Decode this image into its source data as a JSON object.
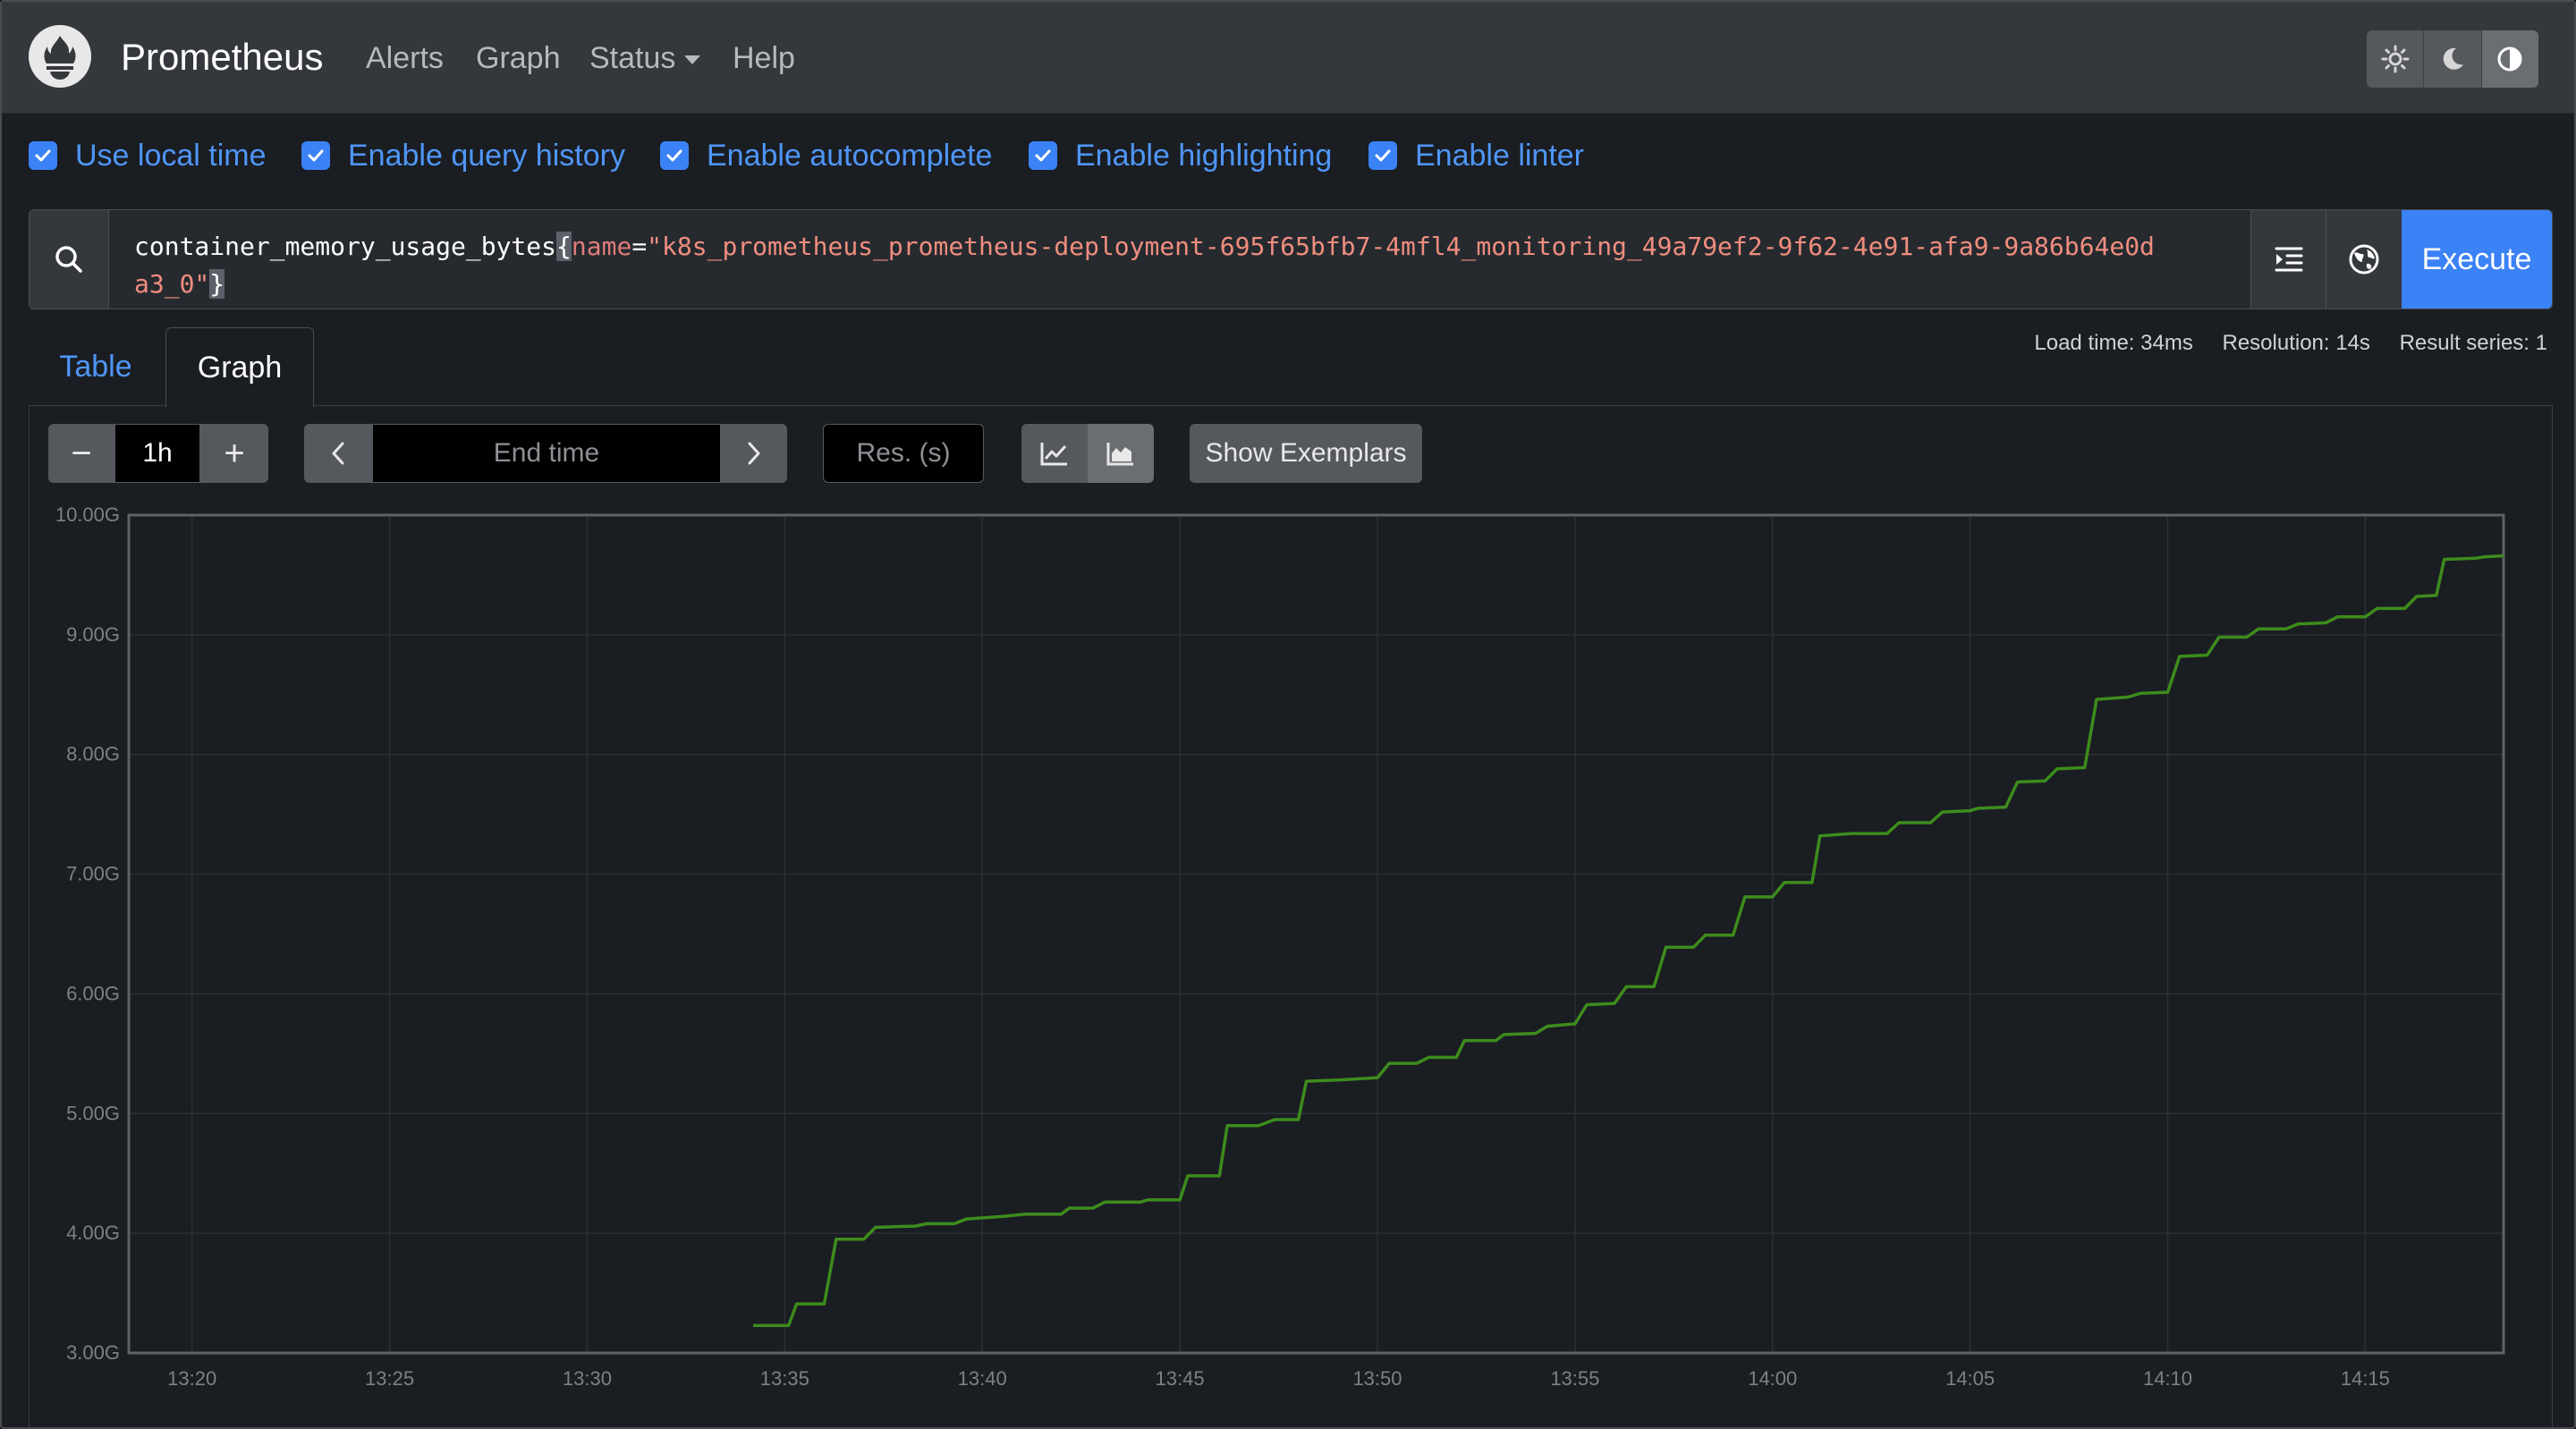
{
  "nav": {
    "brand": "Prometheus",
    "links": [
      "Alerts",
      "Graph",
      "Status",
      "Help"
    ],
    "theme_icons": [
      "sun-icon",
      "moon-icon",
      "half-circle-icon"
    ]
  },
  "options": [
    {
      "label": "Use local time",
      "checked": true
    },
    {
      "label": "Enable query history",
      "checked": true
    },
    {
      "label": "Enable autocomplete",
      "checked": true
    },
    {
      "label": "Enable highlighting",
      "checked": true
    },
    {
      "label": "Enable linter",
      "checked": true
    }
  ],
  "query": {
    "metric": "container_memory_usage_bytes",
    "open_brace": "{",
    "label": "name",
    "operator": "=",
    "value": "\"k8s_prometheus_prometheus-deployment-695f65bfb7-4mfl4_monitoring_49a79ef2-9f62-4e91-afa9-9a86b64e0da3_0\"",
    "close_brace": "}",
    "execute_label": "Execute"
  },
  "tabs": {
    "table": "Table",
    "graph": "Graph",
    "active": "Graph"
  },
  "stats": {
    "load_time": "Load time: 34ms",
    "resolution": "Resolution: 14s",
    "result_series": "Result series: 1"
  },
  "graph_controls": {
    "range_value": "1h",
    "minus": "−",
    "plus": "+",
    "end_time_placeholder": "End time",
    "resolution_placeholder": "Res. (s)",
    "show_exemplars": "Show Exemplars"
  },
  "colors": {
    "accent": "#3b82f6",
    "series": "#3d8c1c",
    "background": "#1a1d22"
  },
  "chart_data": {
    "type": "line",
    "ylim": [
      3.0,
      10.0
    ],
    "yticks": [
      3,
      4,
      5,
      6,
      7,
      8,
      9,
      10
    ],
    "ytick_labels": [
      "3.00G",
      "4.00G",
      "5.00G",
      "6.00G",
      "7.00G",
      "8.00G",
      "9.00G",
      "10.00G"
    ],
    "xlim_minutes": [
      1098.4,
      1158.5
    ],
    "xticks_minutes": [
      1100,
      1105,
      1110,
      1115,
      1120,
      1125,
      1130,
      1135,
      1140,
      1145,
      1150,
      1155
    ],
    "xtick_labels": [
      "13:20",
      "13:25",
      "13:30",
      "13:35",
      "13:40",
      "13:45",
      "13:50",
      "13:55",
      "14:00",
      "14:05",
      "14:10",
      "14:15"
    ],
    "grid": true,
    "series": [
      {
        "values": [
          [
            1114.2,
            3.23
          ],
          [
            1115.1,
            3.23
          ],
          [
            1115.3,
            3.41
          ],
          [
            1116.0,
            3.41
          ],
          [
            1116.3,
            3.95
          ],
          [
            1117.0,
            3.95
          ],
          [
            1117.3,
            4.05
          ],
          [
            1118.3,
            4.06
          ],
          [
            1118.6,
            4.08
          ],
          [
            1119.3,
            4.08
          ],
          [
            1119.6,
            4.12
          ],
          [
            1120.5,
            4.14
          ],
          [
            1121.1,
            4.16
          ],
          [
            1122.0,
            4.16
          ],
          [
            1122.2,
            4.21
          ],
          [
            1122.8,
            4.21
          ],
          [
            1123.1,
            4.26
          ],
          [
            1124.0,
            4.26
          ],
          [
            1124.2,
            4.28
          ],
          [
            1125.0,
            4.28
          ],
          [
            1125.2,
            4.48
          ],
          [
            1126.0,
            4.48
          ],
          [
            1126.2,
            4.9
          ],
          [
            1127.0,
            4.9
          ],
          [
            1127.4,
            4.95
          ],
          [
            1128.0,
            4.95
          ],
          [
            1128.2,
            5.27
          ],
          [
            1129.0,
            5.28
          ],
          [
            1130.0,
            5.3
          ],
          [
            1130.3,
            5.42
          ],
          [
            1131.0,
            5.42
          ],
          [
            1131.3,
            5.47
          ],
          [
            1132.0,
            5.47
          ],
          [
            1132.2,
            5.61
          ],
          [
            1133.0,
            5.61
          ],
          [
            1133.2,
            5.66
          ],
          [
            1134.0,
            5.67
          ],
          [
            1134.3,
            5.73
          ],
          [
            1135.0,
            5.75
          ],
          [
            1135.3,
            5.91
          ],
          [
            1136.0,
            5.92
          ],
          [
            1136.3,
            6.06
          ],
          [
            1137.0,
            6.06
          ],
          [
            1137.3,
            6.39
          ],
          [
            1138.0,
            6.39
          ],
          [
            1138.3,
            6.49
          ],
          [
            1139.0,
            6.49
          ],
          [
            1139.3,
            6.81
          ],
          [
            1140.0,
            6.81
          ],
          [
            1140.3,
            6.93
          ],
          [
            1141.0,
            6.93
          ],
          [
            1141.2,
            7.32
          ],
          [
            1142.0,
            7.34
          ],
          [
            1142.9,
            7.34
          ],
          [
            1143.2,
            7.43
          ],
          [
            1144.0,
            7.43
          ],
          [
            1144.3,
            7.52
          ],
          [
            1145.0,
            7.53
          ],
          [
            1145.2,
            7.55
          ],
          [
            1145.9,
            7.56
          ],
          [
            1146.2,
            7.77
          ],
          [
            1146.9,
            7.78
          ],
          [
            1147.2,
            7.88
          ],
          [
            1147.9,
            7.89
          ],
          [
            1148.2,
            8.46
          ],
          [
            1149.0,
            8.48
          ],
          [
            1149.3,
            8.51
          ],
          [
            1150.0,
            8.52
          ],
          [
            1150.3,
            8.82
          ],
          [
            1151.0,
            8.83
          ],
          [
            1151.3,
            8.98
          ],
          [
            1152.0,
            8.98
          ],
          [
            1152.3,
            9.05
          ],
          [
            1153.0,
            9.05
          ],
          [
            1153.3,
            9.09
          ],
          [
            1154.0,
            9.1
          ],
          [
            1154.3,
            9.15
          ],
          [
            1155.0,
            9.15
          ],
          [
            1155.3,
            9.22
          ],
          [
            1156.0,
            9.22
          ],
          [
            1156.3,
            9.32
          ],
          [
            1156.8,
            9.33
          ],
          [
            1157.0,
            9.63
          ],
          [
            1157.8,
            9.64
          ],
          [
            1158.0,
            9.65
          ],
          [
            1158.5,
            9.66
          ]
        ]
      }
    ]
  }
}
